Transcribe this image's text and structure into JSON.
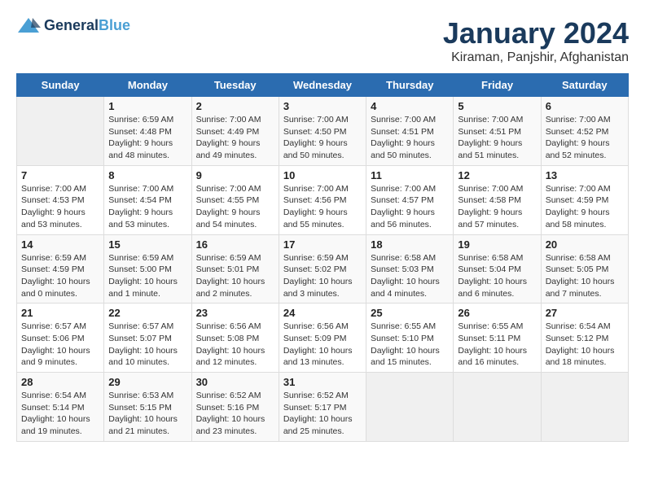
{
  "header": {
    "logo_line1": "General",
    "logo_line2": "Blue",
    "month": "January 2024",
    "location": "Kiraman, Panjshir, Afghanistan"
  },
  "weekdays": [
    "Sunday",
    "Monday",
    "Tuesday",
    "Wednesday",
    "Thursday",
    "Friday",
    "Saturday"
  ],
  "weeks": [
    [
      {
        "day": "",
        "info": ""
      },
      {
        "day": "1",
        "info": "Sunrise: 6:59 AM\nSunset: 4:48 PM\nDaylight: 9 hours\nand 48 minutes."
      },
      {
        "day": "2",
        "info": "Sunrise: 7:00 AM\nSunset: 4:49 PM\nDaylight: 9 hours\nand 49 minutes."
      },
      {
        "day": "3",
        "info": "Sunrise: 7:00 AM\nSunset: 4:50 PM\nDaylight: 9 hours\nand 50 minutes."
      },
      {
        "day": "4",
        "info": "Sunrise: 7:00 AM\nSunset: 4:51 PM\nDaylight: 9 hours\nand 50 minutes."
      },
      {
        "day": "5",
        "info": "Sunrise: 7:00 AM\nSunset: 4:51 PM\nDaylight: 9 hours\nand 51 minutes."
      },
      {
        "day": "6",
        "info": "Sunrise: 7:00 AM\nSunset: 4:52 PM\nDaylight: 9 hours\nand 52 minutes."
      }
    ],
    [
      {
        "day": "7",
        "info": "Sunrise: 7:00 AM\nSunset: 4:53 PM\nDaylight: 9 hours\nand 53 minutes."
      },
      {
        "day": "8",
        "info": "Sunrise: 7:00 AM\nSunset: 4:54 PM\nDaylight: 9 hours\nand 53 minutes."
      },
      {
        "day": "9",
        "info": "Sunrise: 7:00 AM\nSunset: 4:55 PM\nDaylight: 9 hours\nand 54 minutes."
      },
      {
        "day": "10",
        "info": "Sunrise: 7:00 AM\nSunset: 4:56 PM\nDaylight: 9 hours\nand 55 minutes."
      },
      {
        "day": "11",
        "info": "Sunrise: 7:00 AM\nSunset: 4:57 PM\nDaylight: 9 hours\nand 56 minutes."
      },
      {
        "day": "12",
        "info": "Sunrise: 7:00 AM\nSunset: 4:58 PM\nDaylight: 9 hours\nand 57 minutes."
      },
      {
        "day": "13",
        "info": "Sunrise: 7:00 AM\nSunset: 4:59 PM\nDaylight: 9 hours\nand 58 minutes."
      }
    ],
    [
      {
        "day": "14",
        "info": "Sunrise: 6:59 AM\nSunset: 4:59 PM\nDaylight: 10 hours\nand 0 minutes."
      },
      {
        "day": "15",
        "info": "Sunrise: 6:59 AM\nSunset: 5:00 PM\nDaylight: 10 hours\nand 1 minute."
      },
      {
        "day": "16",
        "info": "Sunrise: 6:59 AM\nSunset: 5:01 PM\nDaylight: 10 hours\nand 2 minutes."
      },
      {
        "day": "17",
        "info": "Sunrise: 6:59 AM\nSunset: 5:02 PM\nDaylight: 10 hours\nand 3 minutes."
      },
      {
        "day": "18",
        "info": "Sunrise: 6:58 AM\nSunset: 5:03 PM\nDaylight: 10 hours\nand 4 minutes."
      },
      {
        "day": "19",
        "info": "Sunrise: 6:58 AM\nSunset: 5:04 PM\nDaylight: 10 hours\nand 6 minutes."
      },
      {
        "day": "20",
        "info": "Sunrise: 6:58 AM\nSunset: 5:05 PM\nDaylight: 10 hours\nand 7 minutes."
      }
    ],
    [
      {
        "day": "21",
        "info": "Sunrise: 6:57 AM\nSunset: 5:06 PM\nDaylight: 10 hours\nand 9 minutes."
      },
      {
        "day": "22",
        "info": "Sunrise: 6:57 AM\nSunset: 5:07 PM\nDaylight: 10 hours\nand 10 minutes."
      },
      {
        "day": "23",
        "info": "Sunrise: 6:56 AM\nSunset: 5:08 PM\nDaylight: 10 hours\nand 12 minutes."
      },
      {
        "day": "24",
        "info": "Sunrise: 6:56 AM\nSunset: 5:09 PM\nDaylight: 10 hours\nand 13 minutes."
      },
      {
        "day": "25",
        "info": "Sunrise: 6:55 AM\nSunset: 5:10 PM\nDaylight: 10 hours\nand 15 minutes."
      },
      {
        "day": "26",
        "info": "Sunrise: 6:55 AM\nSunset: 5:11 PM\nDaylight: 10 hours\nand 16 minutes."
      },
      {
        "day": "27",
        "info": "Sunrise: 6:54 AM\nSunset: 5:12 PM\nDaylight: 10 hours\nand 18 minutes."
      }
    ],
    [
      {
        "day": "28",
        "info": "Sunrise: 6:54 AM\nSunset: 5:14 PM\nDaylight: 10 hours\nand 19 minutes."
      },
      {
        "day": "29",
        "info": "Sunrise: 6:53 AM\nSunset: 5:15 PM\nDaylight: 10 hours\nand 21 minutes."
      },
      {
        "day": "30",
        "info": "Sunrise: 6:52 AM\nSunset: 5:16 PM\nDaylight: 10 hours\nand 23 minutes."
      },
      {
        "day": "31",
        "info": "Sunrise: 6:52 AM\nSunset: 5:17 PM\nDaylight: 10 hours\nand 25 minutes."
      },
      {
        "day": "",
        "info": ""
      },
      {
        "day": "",
        "info": ""
      },
      {
        "day": "",
        "info": ""
      }
    ]
  ]
}
